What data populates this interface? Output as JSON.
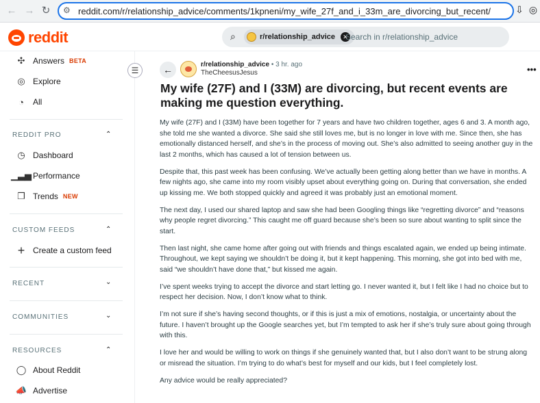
{
  "browser": {
    "url": "reddit.com/r/relationship_advice/comments/1kpneni/my_wife_27f_and_i_33m_are_divorcing_but_recent/"
  },
  "header": {
    "logo_text": "reddit",
    "search_chip": "r/relationship_advice",
    "search_placeholder": "Search in r/relationship_advice"
  },
  "sidebar": {
    "top_items": [
      {
        "label": "Answers",
        "badge": "BETA",
        "icon": "answers-icon"
      },
      {
        "label": "Explore",
        "icon": "explore-icon"
      },
      {
        "label": "All",
        "icon": "all-icon"
      }
    ],
    "reddit_pro": {
      "heading": "REDDIT PRO",
      "items": [
        {
          "label": "Dashboard",
          "icon": "dashboard-icon"
        },
        {
          "label": "Performance",
          "icon": "performance-icon"
        },
        {
          "label": "Trends",
          "badge": "NEW",
          "icon": "trends-icon"
        }
      ]
    },
    "custom_feeds": {
      "heading": "CUSTOM FEEDS",
      "items": [
        {
          "label": "Create a custom feed",
          "icon": "plus-icon"
        }
      ]
    },
    "recent": {
      "heading": "RECENT"
    },
    "communities": {
      "heading": "COMMUNITIES"
    },
    "resources": {
      "heading": "RESOURCES",
      "items": [
        {
          "label": "About Reddit",
          "icon": "about-icon"
        },
        {
          "label": "Advertise",
          "icon": "advertise-icon"
        }
      ]
    }
  },
  "post": {
    "subreddit": "r/relationship_advice",
    "time": "• 3 hr. ago",
    "author": "TheCheesusJesus",
    "title": "My wife (27F) and I (33M) are divorcing, but recent events are making me question everything.",
    "paragraphs": [
      "My wife (27F) and I (33M) have been together for 7 years and have two children together, ages 6 and 3. A month ago, she told me she wanted a divorce. She said she still loves me, but is no longer in love with me. Since then, she has emotionally distanced herself, and she’s in the process of moving out. She’s also admitted to seeing another guy in the last 2 months, which has caused a lot of tension between us.",
      "Despite that, this past week has been confusing. We’ve actually been getting along better than we have in months. A few nights ago, she came into my room visibly upset about everything going on. During that conversation, she ended up kissing me. We both stopped quickly and agreed it was probably just an emotional moment.",
      "The next day, I used our shared laptop and saw she had been Googling things like “regretting divorce” and “reasons why people regret divorcing.” This caught me off guard because she’s been so sure about wanting to split since the start.",
      "Then last night, she came home after going out with friends and things escalated again, we ended up being intimate. Throughout, we kept saying we shouldn’t be doing it, but it kept happening. This morning, she got into bed with me, said “we shouldn’t have done that,” but kissed me again.",
      "I’ve spent weeks trying to accept the divorce and start letting go. I never wanted it, but I felt like I had no choice but to respect her decision. Now, I don’t know what to think.",
      "I’m not sure if she’s having second thoughts, or if this is just a mix of emotions, nostalgia, or uncertainty about the future. I haven’t brought up the Google searches yet, but I’m tempted to ask her if she’s truly sure about going through with this.",
      "I love her and would be willing to work on things if she genuinely wanted that, but I also don’t want to be strung along or misread the situation. I’m trying to do what’s best for myself and our kids, but I feel completely lost.",
      "Any advice would be really appreciated?"
    ]
  },
  "colors": {
    "accent": "#ff4500",
    "badge": "#d93a00",
    "url_focus": "#1a73e8"
  }
}
